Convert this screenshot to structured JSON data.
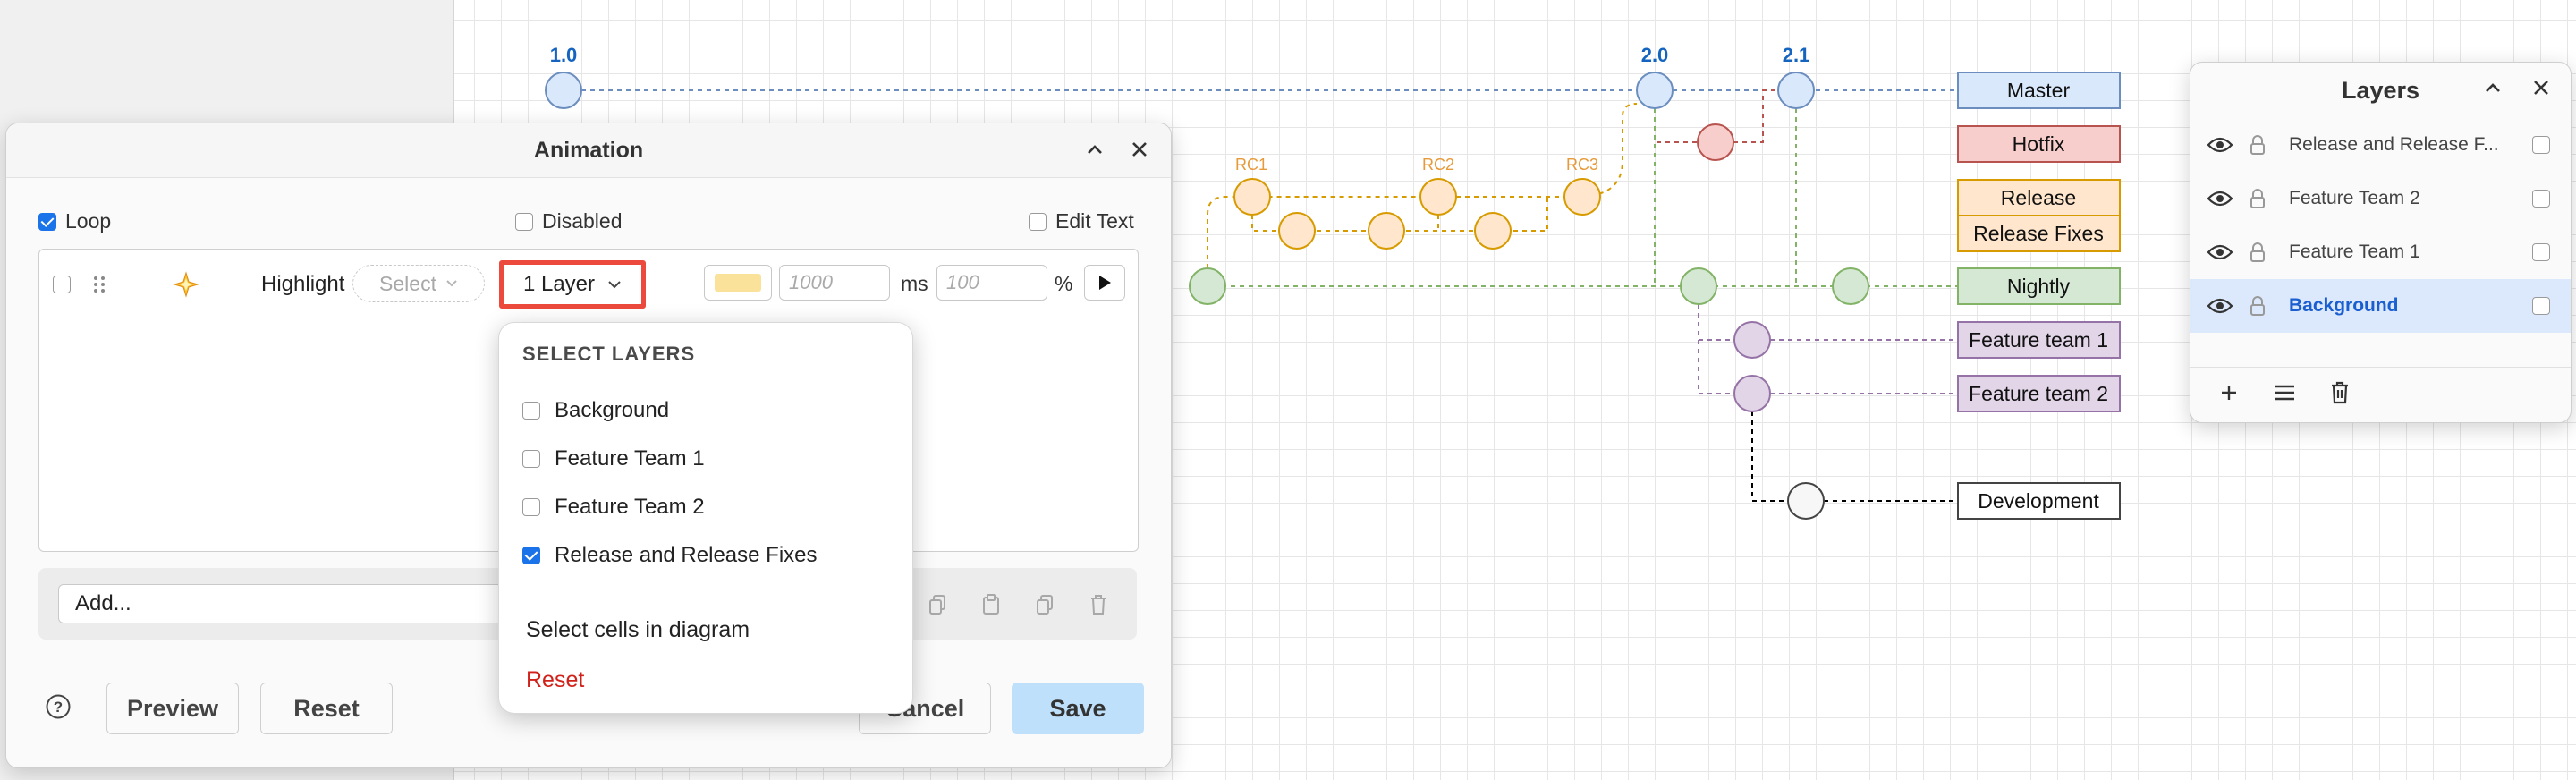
{
  "diagram": {
    "versions": [
      "1.0",
      "2.0",
      "2.1"
    ],
    "release_candidates": [
      "RC1",
      "RC2",
      "RC3"
    ],
    "branches": [
      "Master",
      "Hotfix",
      "Release",
      "Release Fixes",
      "Nightly",
      "Feature team 1",
      "Feature team 2",
      "Development"
    ],
    "colors": {
      "master": "#dae8fc",
      "master_line": "#6c8ebf",
      "hotfix": "#f8cecc",
      "hotfix_line": "#b85450",
      "release": "#ffe6cc",
      "release_line": "#d79b00",
      "nightly": "#d5e8d4",
      "nightly_line": "#82b366",
      "feature": "#e1d5e7",
      "feature_line": "#9673a6"
    }
  },
  "animation": {
    "title": "Animation",
    "loop_label": "Loop",
    "loop_checked": true,
    "disabled_label": "Disabled",
    "edit_text_label": "Edit Text",
    "step": {
      "effect": "Highlight",
      "effect_icon": "sparkle-icon",
      "target_placeholder": "Select",
      "layer_button": "1 Layer",
      "duration_placeholder": "1000",
      "duration_unit": "ms",
      "opacity_placeholder": "100",
      "opacity_unit": "%",
      "highlight_color": "#fbe29b"
    },
    "add_placeholder": "Add...",
    "buttons": {
      "preview": "Preview",
      "reset": "Reset",
      "cancel": "Cancel",
      "save": "Save"
    }
  },
  "layer_menu": {
    "heading": "SELECT LAYERS",
    "items": [
      {
        "label": "Background",
        "checked": false
      },
      {
        "label": "Feature Team 1",
        "checked": false
      },
      {
        "label": "Feature Team 2",
        "checked": false
      },
      {
        "label": "Release and Release Fixes",
        "checked": true
      }
    ],
    "select_cells": "Select cells in diagram",
    "reset": "Reset"
  },
  "layers_panel": {
    "title": "Layers",
    "rows": [
      {
        "name": "Release and Release F...",
        "selected": false
      },
      {
        "name": "Feature Team 2",
        "selected": false
      },
      {
        "name": "Feature Team 1",
        "selected": false
      },
      {
        "name": "Background",
        "selected": true
      }
    ]
  }
}
